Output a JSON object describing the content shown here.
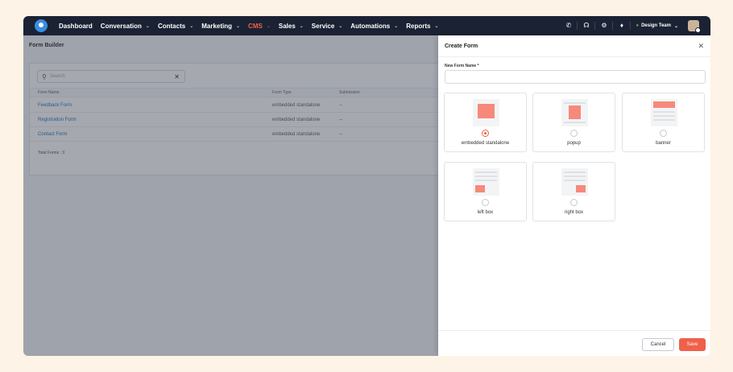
{
  "nav": {
    "items": [
      {
        "label": "Dashboard",
        "chevron": false,
        "active": false
      },
      {
        "label": "Conversation",
        "chevron": true,
        "active": false
      },
      {
        "label": "Contacts",
        "chevron": true,
        "active": false
      },
      {
        "label": "Marketing",
        "chevron": true,
        "active": false
      },
      {
        "label": "CMS",
        "chevron": true,
        "active": true
      },
      {
        "label": "Sales",
        "chevron": true,
        "active": false
      },
      {
        "label": "Service",
        "chevron": true,
        "active": false
      },
      {
        "label": "Automations",
        "chevron": true,
        "active": false
      },
      {
        "label": "Reports",
        "chevron": true,
        "active": false
      }
    ],
    "team_label": "Design Team",
    "icons": [
      "phone-icon",
      "headset-icon",
      "gear-icon",
      "bell-icon"
    ]
  },
  "page": {
    "title": "Form Builder",
    "search_placeholder": "Search",
    "columns": [
      "Form Name",
      "Form Type",
      "Submission"
    ],
    "rows": [
      {
        "name": "Feedback Form",
        "type": "embedded standalone",
        "submissions": "--"
      },
      {
        "name": "Registration Form",
        "type": "embedded standalone",
        "submissions": "--"
      },
      {
        "name": "Contact Form",
        "type": "embedded standalone",
        "submissions": "--"
      }
    ],
    "total": "Total Forms : 3"
  },
  "drawer": {
    "title": "Create Form",
    "field_label": "New Form Name *",
    "field_value": "",
    "types": [
      {
        "label": "embedded standalone",
        "selected": true
      },
      {
        "label": "popup",
        "selected": false
      },
      {
        "label": "banner",
        "selected": false
      },
      {
        "label": "left box",
        "selected": false
      },
      {
        "label": "right box",
        "selected": false
      }
    ],
    "cancel": "Cancel",
    "save": "Save"
  },
  "colors": {
    "accent": "#f0604a",
    "nav_bg": "#1b2233",
    "link": "#2a7bbf",
    "page_bg": "#fdf3e6"
  }
}
